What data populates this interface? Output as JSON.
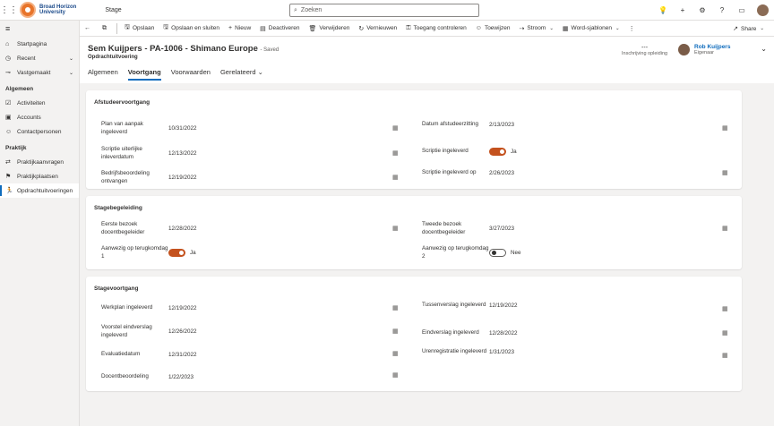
{
  "topbar": {
    "org_line1": "Broad Horizon",
    "org_line2": "University",
    "app_name": "Stage",
    "search_placeholder": "Zoeken"
  },
  "sidebar": {
    "items_top": [
      {
        "label": "Startpagina",
        "icon": "home-icon"
      },
      {
        "label": "Recent",
        "icon": "clock-icon"
      },
      {
        "label": "Vastgemaakt",
        "icon": "pin-icon"
      }
    ],
    "group1": "Algemeen",
    "group1_items": [
      {
        "label": "Activiteiten",
        "icon": "activities-icon"
      },
      {
        "label": "Accounts",
        "icon": "accounts-icon"
      },
      {
        "label": "Contactpersonen",
        "icon": "contacts-icon"
      }
    ],
    "group2": "Praktijk",
    "group2_items": [
      {
        "label": "Praktijkaanvragen",
        "icon": "requests-icon"
      },
      {
        "label": "Praktijkplaatsen",
        "icon": "places-icon"
      },
      {
        "label": "Opdrachtuitvoeringen",
        "icon": "runner-icon"
      }
    ]
  },
  "commands": {
    "save": "Opslaan",
    "save_close": "Opslaan en sluiten",
    "new": "Nieuw",
    "deactivate": "Deactiveren",
    "delete": "Verwijderen",
    "refresh": "Vernieuwen",
    "check_access": "Toegang controleren",
    "assign": "Toewijzen",
    "flow": "Stroom",
    "word_templates": "Word-sjablonen",
    "share": "Share"
  },
  "header": {
    "title": "Sem Kuijpers - PA-1006 - Shimano Europe",
    "saved": "- Saved",
    "entity": "Opdrachtuitvoering",
    "field_value": "---",
    "field_label": "Inschrijving opleiding",
    "owner_name": "Rob Kuijpers",
    "owner_role": "Eigenaar"
  },
  "tabs": [
    "Algemeen",
    "Voortgang",
    "Voorwaarden",
    "Gerelateerd"
  ],
  "sections": {
    "afstudeer": {
      "title": "Afstudeervoortgang",
      "plan_label": "Plan van aanpak ingeleverd",
      "plan_value": "10/31/2022",
      "scriptie_uiterlijk_label": "Scriptie uiterlijke inleverdatum",
      "scriptie_uiterlijk_value": "12/13/2022",
      "bedrijf_label": "Bedrijfsbeoordeling ontvangen",
      "bedrijf_value": "12/19/2022",
      "datum_afstudeer_label": "Datum afstudeerzitting",
      "datum_afstudeer_value": "2/13/2023",
      "scriptie_ingeleverd_label": "Scriptie ingeleverd",
      "scriptie_ingeleverd_value": "Ja",
      "scriptie_ingeleverd_op_label": "Scriptie ingeleverd op",
      "scriptie_ingeleverd_op_value": "2/26/2023"
    },
    "begeleiding": {
      "title": "Stagebegeleiding",
      "eerste_label": "Eerste bezoek docentbegeleider",
      "eerste_value": "12/28/2022",
      "aanwezig1_label": "Aanwezig op terugkomdag 1",
      "aanwezig1_value": "Ja",
      "tweede_label": "Tweede bezoek docentbegeleider",
      "tweede_value": "3/27/2023",
      "aanwezig2_label": "Aanwezig op terugkomdag 2",
      "aanwezig2_value": "Nee"
    },
    "stagevoortgang": {
      "title": "Stagevoortgang",
      "werkplan_label": "Werkplan ingeleverd",
      "werkplan_value": "12/19/2022",
      "voorstel_label": "Voorstel eindverslag ingeleverd",
      "voorstel_value": "12/26/2022",
      "evaluatie_label": "Evaluatiedatum",
      "evaluatie_value": "12/31/2022",
      "docent_label": "Docentbeoordeling",
      "docent_value": "1/22/2023",
      "tussen_label": "Tussenverslag ingeleverd",
      "tussen_value": "12/19/2022",
      "eind_label": "Eindverslag ingeleverd",
      "eind_value": "12/28/2022",
      "uren_label": "Urenregistratie ingeleverd",
      "uren_value": "1/31/2023"
    }
  },
  "colors": {
    "accent": "#0f6cbd",
    "toggle_on": "#c4521e",
    "brand_orange": "#e8742a"
  }
}
